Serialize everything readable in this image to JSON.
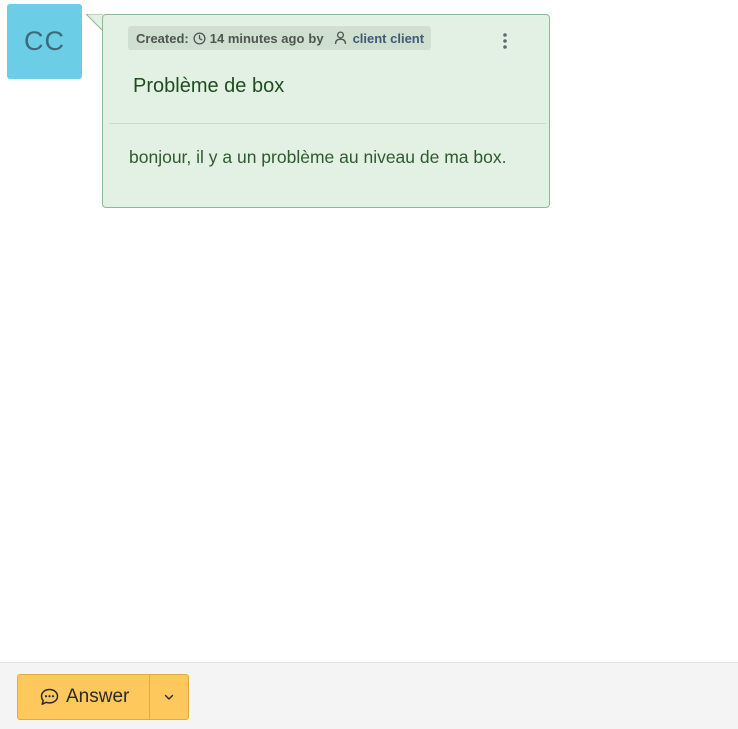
{
  "avatar": {
    "initials": "CC",
    "color": "#6ccde6"
  },
  "message": {
    "created_label": "Created:",
    "time_ago": "14 minutes ago",
    "by_label": "by",
    "author": "client client",
    "title": "Problème de box",
    "body": "bonjour, il y a un problème au niveau de ma box.",
    "background": "#e2f1e3",
    "icons": {
      "clock": "clock-icon",
      "user": "user-icon",
      "actions": "kebab-menu-icon"
    }
  },
  "footer": {
    "answer_label": "Answer",
    "answer_color": "#fec85c",
    "icons": {
      "answer": "chat-bubble-icon",
      "dropdown": "chevron-down-icon"
    }
  }
}
